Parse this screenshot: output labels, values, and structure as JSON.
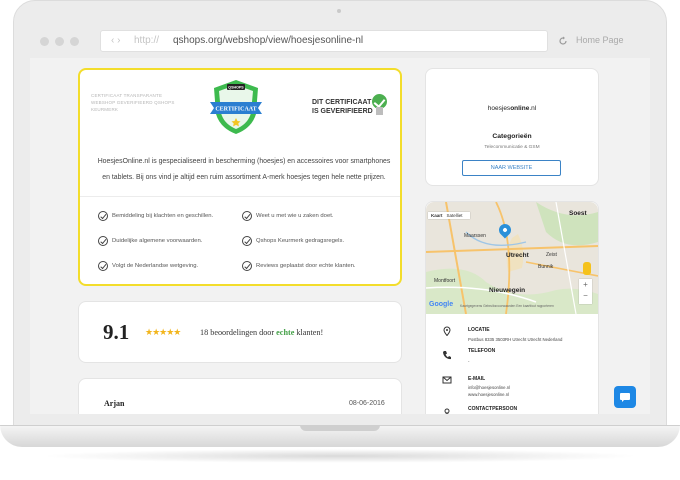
{
  "browser": {
    "nav_arrows": "‹  ›",
    "protocol": "http://",
    "url": "qshops.org/webshop/view/hoesjesonline-nl",
    "reload_icon": "reload-icon",
    "home_label": "Home Page"
  },
  "certificate": {
    "small_text": "CERTIFICAAT TRANSPARANTE WEBSHOP GEVERIFIEERD QSHOPS KEURMERK",
    "badge_brand": "QSHOPS",
    "badge_label": "CERTIFICAAT",
    "verified_line1": "DIT CERTIFICAAT",
    "verified_line2": "IS GEVERIFIEERD",
    "description": "HoesjesOnline.nl is gespecialiseerd in bescherming (hoesjes) en accessoires voor smartphones en tablets. Bij ons vind je altijd een ruim assortiment A-merk hoesjes tegen hele nette prijzen.",
    "bullets": [
      "Bemiddeling bij klachten en geschillen.",
      "Weet u met wie u zaken doet.",
      "Duidelijke algemene voorwaarden.",
      "Qshops Keurmerk gedragsregels.",
      "Volgt de Nederlandse wetgeving.",
      "Reviews geplaatst door echte klanten."
    ],
    "colors": {
      "border": "#f3dd2b",
      "badge_green": "#3dba4e",
      "badge_blue": "#2b7fd1"
    }
  },
  "rating": {
    "score": "9.1",
    "stars": "★★★★★",
    "text_before": "18 beoordelingen door ",
    "text_highlight": "echte",
    "text_after": " klanten!"
  },
  "review": {
    "name": "Arjan",
    "date": "08-06-2016"
  },
  "shop": {
    "name_prefix": "hoesjes",
    "name_bold": "online",
    "name_suffix": ".nl",
    "categories_title": "Categorieën",
    "categories_value": "Telecommunicatie & GSM",
    "website_button": "NAAR WEBSITE"
  },
  "map": {
    "tab_map": "Kaart",
    "tab_satellite": "Satelliet",
    "labels": {
      "soest": "Soest",
      "maarssen": "Maarssen",
      "utrecht": "Utrecht",
      "zeist": "Zeist",
      "bunnik": "Bunnik",
      "montfoort": "Montfoort",
      "nieuwegein": "Nieuwegein"
    },
    "google": "Google",
    "footer": "Kaartgegevens   Gebruiksvoorwaarden   Een kaartfout rapporteren"
  },
  "contact": {
    "location_label": "LOCATIE",
    "location_value": "Postbus 8335 3503RH Utrecht Utrecht Nederland",
    "phone_label": "TELEFOON",
    "phone_value": "-",
    "email_label": "E-MAIL",
    "email_value1": "info@hoesjesonline.nl",
    "email_value2": "www.hoesjesonline.nl",
    "person_label": "CONTACTPERSOON"
  }
}
